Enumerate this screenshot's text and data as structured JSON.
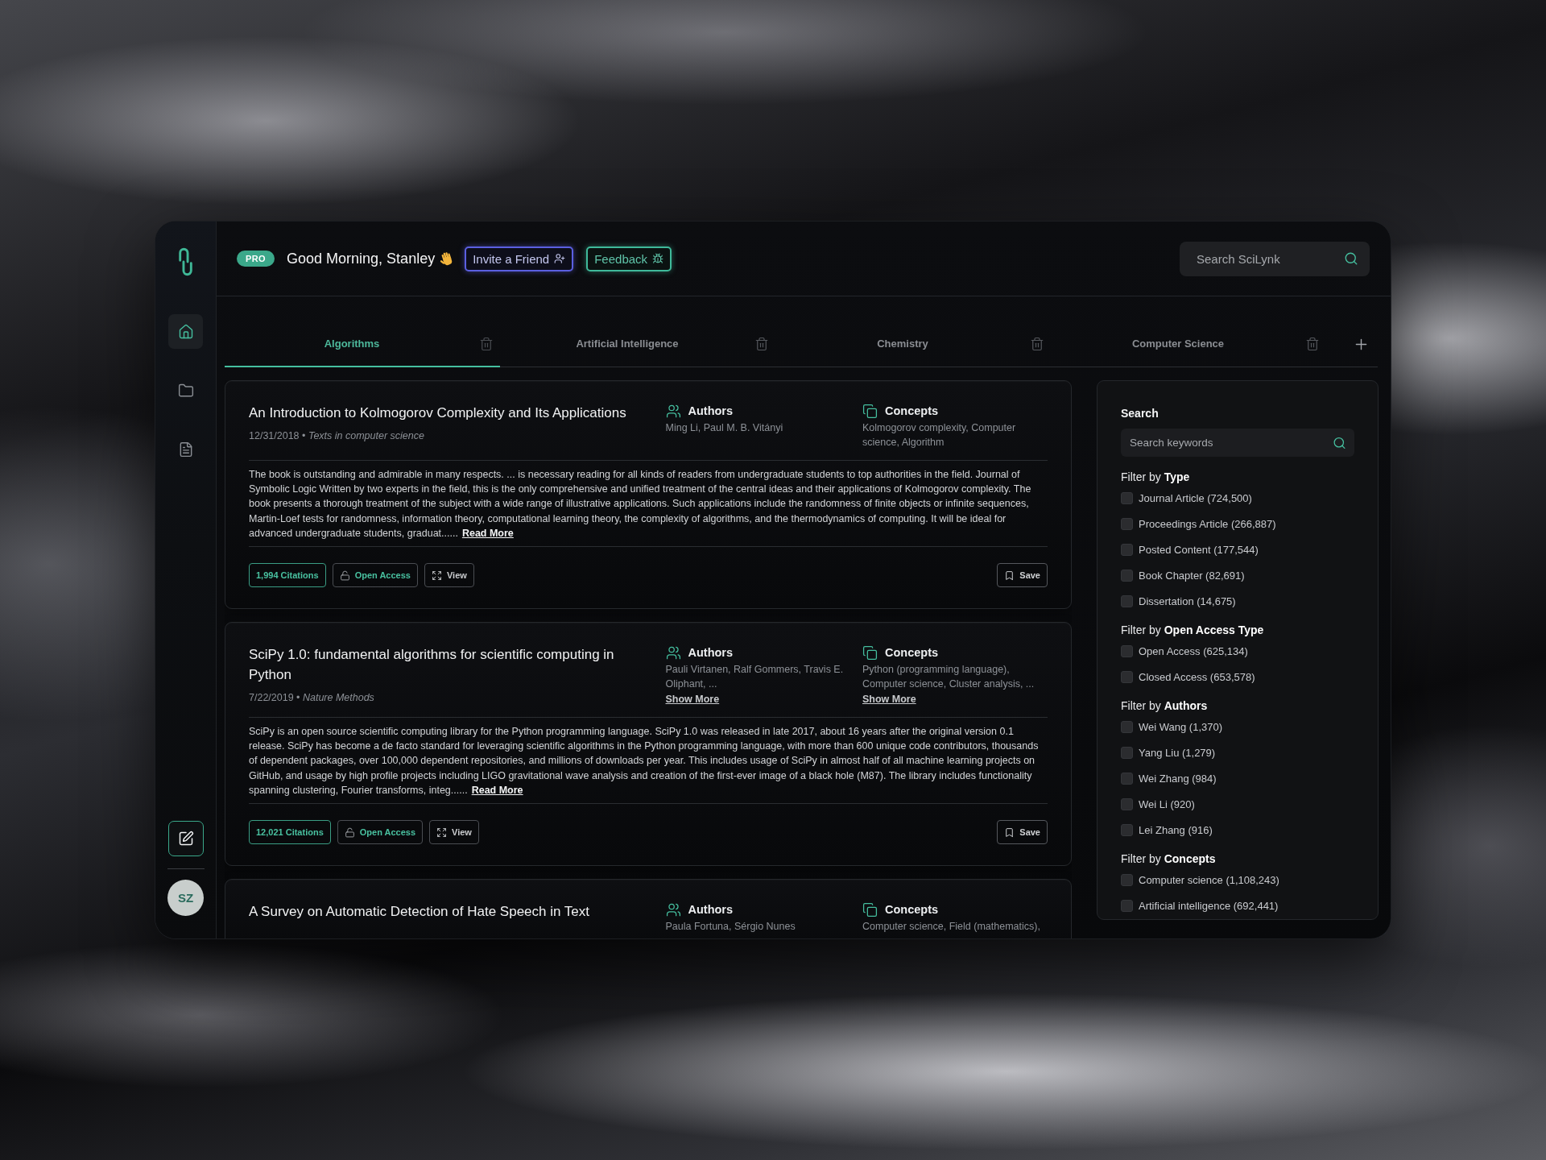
{
  "sidebar": {
    "nav_items": [
      {
        "kind": "home",
        "selected": true
      },
      {
        "kind": "folder",
        "selected": false
      },
      {
        "kind": "document",
        "selected": false
      }
    ],
    "avatar": {
      "initials": "SZ"
    }
  },
  "header": {
    "badge": "PRO",
    "greeting": "Good Morning, Stanley",
    "buttons": [
      {
        "kind": "invite",
        "label": "Invite a Friend"
      },
      {
        "kind": "feedback",
        "label": "Feedback"
      }
    ],
    "search": {
      "placeholder": "Search SciLynk"
    }
  },
  "tabs": [
    {
      "label": "Algorithms",
      "selected": true
    },
    {
      "label": "Artificial Intelligence",
      "selected": false
    },
    {
      "label": "Chemistry",
      "selected": false
    },
    {
      "label": "Computer Science",
      "selected": false
    }
  ],
  "papers": [
    {
      "title": "An Introduction to Kolmogorov Complexity and Its Applications",
      "meta": "12/31/2018 • *Texts in computer science*",
      "authors": {
        "heading": "Authors",
        "text": "Ming Li, Paul M. B. Vitányi"
      },
      "concepts": {
        "heading": "Concepts",
        "text": "Kolmogorov complexity, Computer science, Algorithm"
      },
      "abstract": "The book is outstanding and admirable in many respects. ... is necessary reading for all kinds of readers from undergraduate students to top authorities in the field. Journal of Symbolic Logic Written by two experts in the field, this is the only comprehensive and unified treatment of the central ideas and their applications of Kolmogorov complexity. The book presents a thorough treatment of the subject with a wide range of illustrative applications. Such applications include the randomness of finite objects or infinite sequences, Martin-Loef tests for randomness, information theory, computational learning theory, the complexity of algorithms, and the thermodynamics of computing. It will be ideal for advanced undergraduate students, graduat......",
      "read_more": "Read More",
      "actions": [
        {
          "kind": "citations",
          "label": "1,994 Citations"
        },
        {
          "kind": "open-access",
          "label": "Open Access"
        },
        {
          "kind": "view",
          "label": "View"
        }
      ],
      "save": "Save"
    },
    {
      "title": "SciPy 1.0: fundamental algorithms for scientific computing in Python",
      "meta": "7/22/2019 • *Nature Methods*",
      "authors": {
        "heading": "Authors",
        "text": "Pauli Virtanen, Ralf Gommers, Travis E. Oliphant, ...",
        "show_more": "Show More"
      },
      "concepts": {
        "heading": "Concepts",
        "text": "Python (programming language), Computer science, Cluster analysis, ...",
        "show_more": "Show More"
      },
      "abstract": "SciPy is an open source scientific computing library for the Python programming language. SciPy 1.0 was released in late 2017, about 16 years after the original version 0.1 release. SciPy has become a de facto standard for leveraging scientific algorithms in the Python programming language, with more than 600 unique code contributors, thousands of dependent packages, over 100,000 dependent repositories, and millions of downloads per year. This includes usage of SciPy in almost half of all machine learning projects on GitHub, and usage by high profile projects including LIGO gravitational wave analysis and creation of the first-ever image of a black hole (M87). The library includes functionality spanning clustering, Fourier transforms, integ......",
      "read_more": "Read More",
      "actions": [
        {
          "kind": "citations",
          "label": "12,021 Citations"
        },
        {
          "kind": "open-access",
          "label": "Open Access"
        },
        {
          "kind": "view",
          "label": "View"
        }
      ],
      "save": "Save"
    },
    {
      "title": "A Survey on Automatic Detection of Hate Speech in Text",
      "authors": {
        "heading": "Authors",
        "text": "Paula Fortuna, Sérgio Nunes"
      },
      "concepts": {
        "heading": "Concepts",
        "text": "Computer science, Field (mathematics),"
      }
    }
  ],
  "filters": {
    "search": {
      "heading": "Search",
      "placeholder": "Search keywords"
    },
    "groups": [
      {
        "heading": "Filter by **Type**",
        "items": [
          {
            "label": "Journal Article (724,500)",
            "checked": false
          },
          {
            "label": "Proceedings Article (266,887)",
            "checked": false
          },
          {
            "label": "Posted Content (177,544)",
            "checked": false
          },
          {
            "label": "Book Chapter (82,691)",
            "checked": false
          },
          {
            "label": "Dissertation (14,675)",
            "checked": false
          }
        ]
      },
      {
        "heading": "Filter by **Open Access Type**",
        "items": [
          {
            "label": "Open Access (625,134)",
            "checked": false
          },
          {
            "label": "Closed Access (653,578)",
            "checked": false
          }
        ]
      },
      {
        "heading": "Filter by **Authors**",
        "items": [
          {
            "label": "Wei Wang (1,370)",
            "checked": false
          },
          {
            "label": "Yang Liu (1,279)",
            "checked": false
          },
          {
            "label": "Wei Zhang (984)",
            "checked": false
          },
          {
            "label": "Wei Li (920)",
            "checked": false
          },
          {
            "label": "Lei Zhang (916)",
            "checked": false
          }
        ]
      },
      {
        "heading": "Filter by **Concepts**",
        "items": [
          {
            "label": "Computer science (1,108,243)",
            "checked": false
          },
          {
            "label": "Artificial intelligence (692,441)",
            "checked": false
          }
        ]
      }
    ]
  }
}
